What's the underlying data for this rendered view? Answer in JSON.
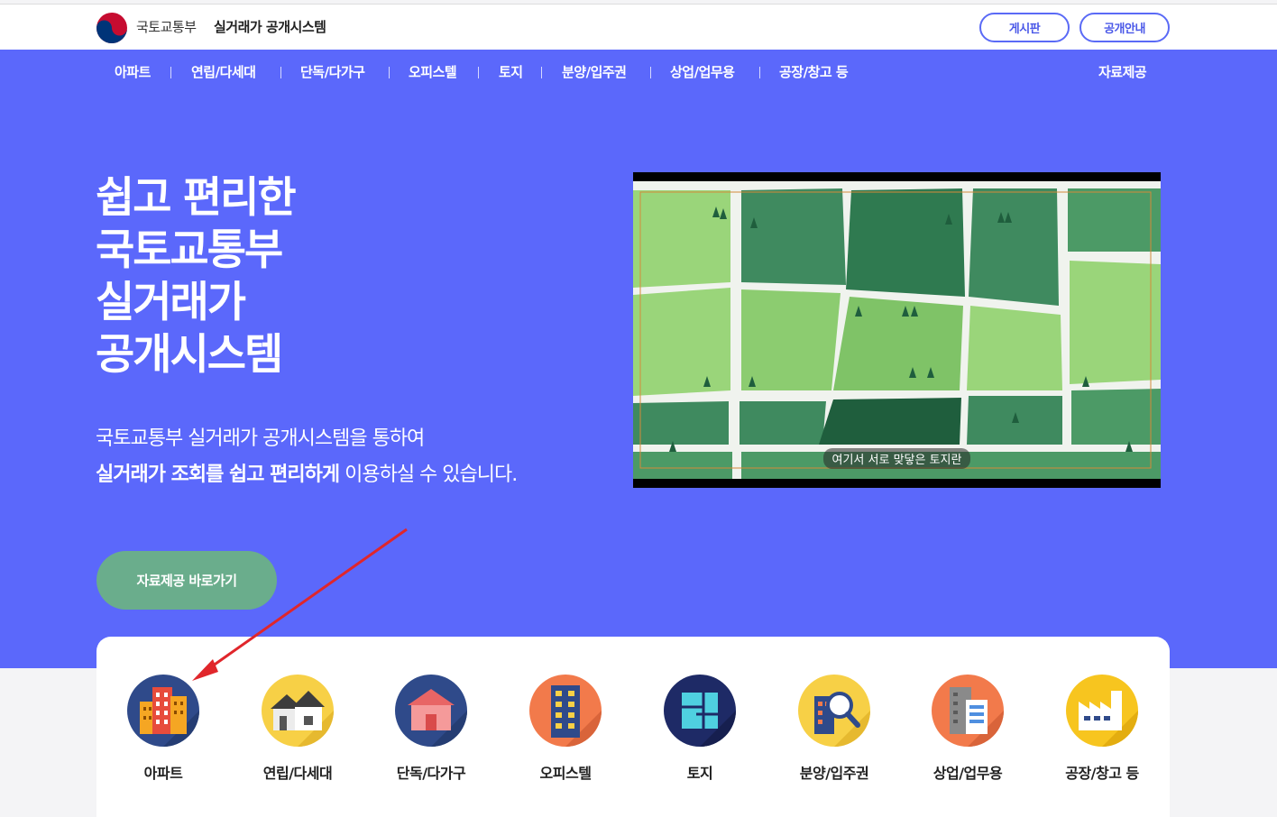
{
  "header": {
    "org_name": "국토교통부",
    "system_name": "실거래가 공개시스템",
    "board_button": "게시판",
    "info_button": "공개안내"
  },
  "nav": {
    "items": [
      "아파트",
      "연립/다세대",
      "단독/다가구",
      "오피스텔",
      "토지",
      "분양/입주권",
      "상업/업무용",
      "공장/창고 등"
    ],
    "data_link": "자료제공"
  },
  "hero": {
    "title_lines": [
      "쉽고 편리한",
      "국토교통부",
      "실거래가",
      "공개시스템"
    ],
    "desc_line1": "국토교통부 실거래가 공개시스템을 통하여",
    "desc_line2_bold": "실거래가 조회를 쉽고 편리하게",
    "desc_line2_rest": " 이용하실 수 있습니다.",
    "cta_button": "자료제공 바로가기",
    "video_subtitle": "여기서 서로 맞닿은 토지란"
  },
  "categories": [
    {
      "label": "아파트",
      "icon": "apartment-icon",
      "bg": "#2f4a8a"
    },
    {
      "label": "연립/다세대",
      "icon": "row-house-icon",
      "bg": "#f7d046"
    },
    {
      "label": "단독/다가구",
      "icon": "house-icon",
      "bg": "#2f4a8a"
    },
    {
      "label": "오피스텔",
      "icon": "officetel-icon",
      "bg": "#f27a4b"
    },
    {
      "label": "토지",
      "icon": "land-icon",
      "bg": "#1e2a66"
    },
    {
      "label": "분양/입주권",
      "icon": "presale-icon",
      "bg": "#f7d046"
    },
    {
      "label": "상업/업무용",
      "icon": "commercial-icon",
      "bg": "#f27a4b"
    },
    {
      "label": "공장/창고 등",
      "icon": "factory-icon",
      "bg": "#f7c51f"
    }
  ],
  "colors": {
    "hero_bg": "#5b68fb",
    "cta_bg": "#6aad8c",
    "annotation_arrow": "#e0262b"
  }
}
